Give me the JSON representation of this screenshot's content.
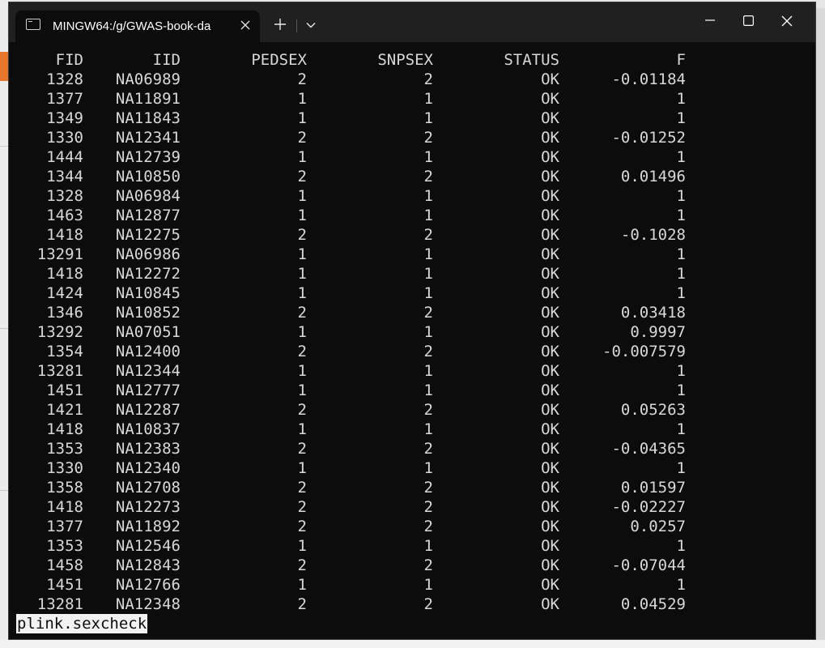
{
  "window": {
    "tab_title": "MINGW64:/g/GWAS-book-da"
  },
  "table": {
    "headers": [
      "FID",
      "IID",
      "PEDSEX",
      "SNPSEX",
      "STATUS",
      "F"
    ],
    "rows": [
      [
        "1328",
        "NA06989",
        "2",
        "2",
        "OK",
        "-0.01184"
      ],
      [
        "1377",
        "NA11891",
        "1",
        "1",
        "OK",
        "1"
      ],
      [
        "1349",
        "NA11843",
        "1",
        "1",
        "OK",
        "1"
      ],
      [
        "1330",
        "NA12341",
        "2",
        "2",
        "OK",
        "-0.01252"
      ],
      [
        "1444",
        "NA12739",
        "1",
        "1",
        "OK",
        "1"
      ],
      [
        "1344",
        "NA10850",
        "2",
        "2",
        "OK",
        "0.01496"
      ],
      [
        "1328",
        "NA06984",
        "1",
        "1",
        "OK",
        "1"
      ],
      [
        "1463",
        "NA12877",
        "1",
        "1",
        "OK",
        "1"
      ],
      [
        "1418",
        "NA12275",
        "2",
        "2",
        "OK",
        "-0.1028"
      ],
      [
        "13291",
        "NA06986",
        "1",
        "1",
        "OK",
        "1"
      ],
      [
        "1418",
        "NA12272",
        "1",
        "1",
        "OK",
        "1"
      ],
      [
        "1424",
        "NA10845",
        "1",
        "1",
        "OK",
        "1"
      ],
      [
        "1346",
        "NA10852",
        "2",
        "2",
        "OK",
        "0.03418"
      ],
      [
        "13292",
        "NA07051",
        "1",
        "1",
        "OK",
        "0.9997"
      ],
      [
        "1354",
        "NA12400",
        "2",
        "2",
        "OK",
        "-0.007579"
      ],
      [
        "13281",
        "NA12344",
        "1",
        "1",
        "OK",
        "1"
      ],
      [
        "1451",
        "NA12777",
        "1",
        "1",
        "OK",
        "1"
      ],
      [
        "1421",
        "NA12287",
        "2",
        "2",
        "OK",
        "0.05263"
      ],
      [
        "1418",
        "NA10837",
        "1",
        "1",
        "OK",
        "1"
      ],
      [
        "1353",
        "NA12383",
        "2",
        "2",
        "OK",
        "-0.04365"
      ],
      [
        "1330",
        "NA12340",
        "1",
        "1",
        "OK",
        "1"
      ],
      [
        "1358",
        "NA12708",
        "2",
        "2",
        "OK",
        "0.01597"
      ],
      [
        "1418",
        "NA12273",
        "2",
        "2",
        "OK",
        "-0.02227"
      ],
      [
        "1377",
        "NA11892",
        "2",
        "2",
        "OK",
        "0.0257"
      ],
      [
        "1353",
        "NA12546",
        "1",
        "1",
        "OK",
        "1"
      ],
      [
        "1458",
        "NA12843",
        "2",
        "2",
        "OK",
        "-0.07044"
      ],
      [
        "1451",
        "NA12766",
        "1",
        "1",
        "OK",
        "1"
      ],
      [
        "13281",
        "NA12348",
        "2",
        "2",
        "OK",
        "0.04529"
      ]
    ]
  },
  "pager": {
    "status_text": "plink.sexcheck"
  },
  "icons": {
    "tab": "terminal-icon",
    "close_tab": "close-icon",
    "new_tab": "plus-icon",
    "dropdown": "chevron-down-icon",
    "minimize": "minimize-icon",
    "maximize": "maximize-icon",
    "close_window": "close-icon"
  },
  "colors": {
    "terminal_bg": "#0c0c0c",
    "titlebar_bg": "#202020",
    "text": "#d8d8d8",
    "prompt_bg": "#f2f2f2"
  }
}
